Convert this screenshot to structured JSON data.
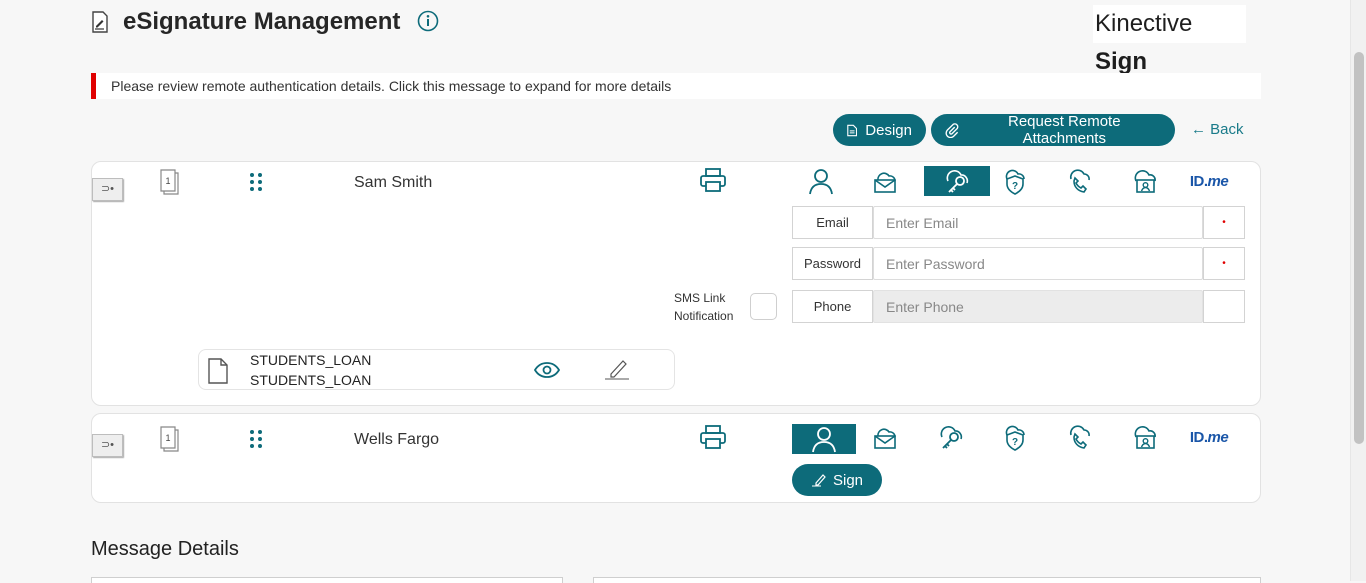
{
  "header": {
    "title": "eSignature Management",
    "brand_regular": "Kinective",
    "brand_bold": "Sign"
  },
  "alert": {
    "message": "Please review remote authentication details. Click this message to expand for more details",
    "color": "#e00000"
  },
  "toolbar": {
    "design_label": "Design",
    "attachments_label": "Request Remote Attachments",
    "back_label": "← Back"
  },
  "theme": {
    "accent": "#0d6b7a"
  },
  "signers": [
    {
      "name": "Sam Smith",
      "active_auth": "password-key",
      "fields": {
        "email_label": "Email",
        "email_placeholder": "Enter Email",
        "password_label": "Password",
        "password_placeholder": "Enter Password",
        "phone_label": "Phone",
        "phone_placeholder": "Enter Phone"
      },
      "sms_label_line1": "SMS Link",
      "sms_label_line2": "Notification",
      "document": {
        "line1": "STUDENTS_LOAN",
        "line2": "STUDENTS_LOAN"
      }
    },
    {
      "name": "Wells Fargo",
      "active_auth": "in-person",
      "sign_label": "Sign"
    }
  ],
  "auth_methods": [
    "in-person",
    "email",
    "password-key",
    "security-question",
    "phone",
    "cloud-id",
    "idme"
  ],
  "idme": {
    "id": "ID.",
    "me": "me"
  },
  "message_details": {
    "title": "Message Details"
  },
  "icons": {
    "header": "document-edit-icon",
    "info": "info-icon",
    "expander": "expand-arrow-icon",
    "pages": "page-count-icon",
    "pages_count": "1",
    "drag": "drag-handle-icon",
    "print": "print-icon",
    "view": "eye-icon",
    "sign": "pen-icon"
  }
}
